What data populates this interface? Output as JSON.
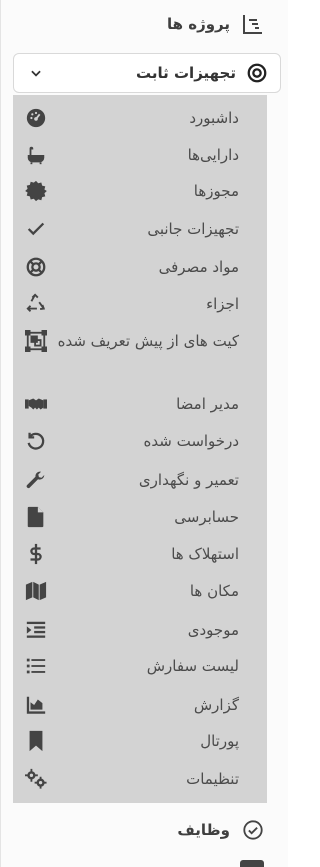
{
  "nav": {
    "projects": {
      "label": "پروژه ها",
      "icon": "project-chart-icon"
    },
    "fixed_assets": {
      "label": "تجهیزات ثابت",
      "icon": "target-icon",
      "chevron": "chevron-down-icon"
    },
    "submenu": [
      {
        "label": "داشبورد",
        "icon": "dashboard-icon"
      },
      {
        "label": "دارایی‌ها",
        "icon": "bathtub-icon"
      },
      {
        "label": "مجوزها",
        "icon": "certificate-icon"
      },
      {
        "label": "تجهیزات جانبی",
        "icon": "check-icon"
      },
      {
        "label": "مواد مصرفی",
        "icon": "lifebuoy-icon"
      },
      {
        "label": "اجزاء",
        "icon": "recycle-icon"
      },
      {
        "label": "کیت های از پیش تعریف شده",
        "icon": "kit-icon"
      },
      {
        "label": "مدیر امضا",
        "icon": "handshake-icon"
      },
      {
        "label": "درخواست شده",
        "icon": "history-icon"
      },
      {
        "label": "تعمیر و نگهداری",
        "icon": "wrench-icon"
      },
      {
        "label": "حسابرسی",
        "icon": "file-icon"
      },
      {
        "label": "استهلاک ها",
        "icon": "dollar-icon"
      },
      {
        "label": "مکان ها",
        "icon": "map-icon"
      },
      {
        "label": "موجودی",
        "icon": "inventory-list-icon"
      },
      {
        "label": "لیست سفارش",
        "icon": "list-icon"
      },
      {
        "label": "گزارش",
        "icon": "report-chart-icon"
      },
      {
        "label": "پورتال",
        "icon": "bookmark-icon"
      },
      {
        "label": "تنظیمات",
        "icon": "gears-icon"
      }
    ],
    "tasks": {
      "label": "وظایف",
      "icon": "check-circle-icon"
    }
  }
}
